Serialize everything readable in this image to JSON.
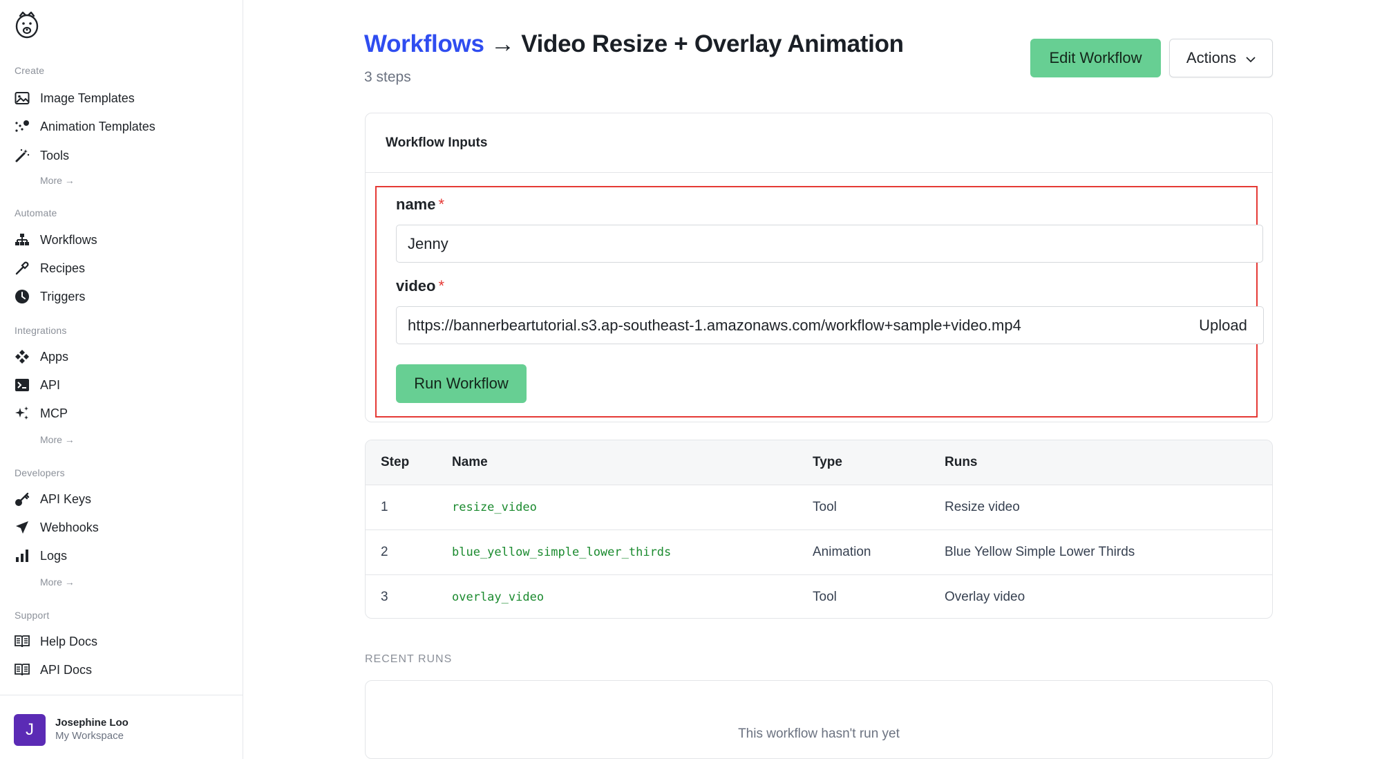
{
  "sidebar": {
    "sections": [
      {
        "title": "Create",
        "items": [
          {
            "label": "Image Templates",
            "icon": "image-icon"
          },
          {
            "label": "Animation Templates",
            "icon": "animation-icon"
          },
          {
            "label": "Tools",
            "icon": "magic-wand-icon"
          }
        ],
        "more": "More →"
      },
      {
        "title": "Automate",
        "items": [
          {
            "label": "Workflows",
            "icon": "sitemap-icon"
          },
          {
            "label": "Recipes",
            "icon": "dropper-icon"
          },
          {
            "label": "Triggers",
            "icon": "clock-icon"
          }
        ]
      },
      {
        "title": "Integrations",
        "items": [
          {
            "label": "Apps",
            "icon": "apps-diamond-icon"
          },
          {
            "label": "API",
            "icon": "terminal-icon"
          },
          {
            "label": "MCP",
            "icon": "sparkles-icon"
          }
        ],
        "more": "More →"
      },
      {
        "title": "Developers",
        "items": [
          {
            "label": "API Keys",
            "icon": "key-icon"
          },
          {
            "label": "Webhooks",
            "icon": "paper-plane-icon"
          },
          {
            "label": "Logs",
            "icon": "bar-chart-icon"
          }
        ],
        "more": "More →"
      },
      {
        "title": "Support",
        "items": [
          {
            "label": "Help Docs",
            "icon": "book-icon"
          },
          {
            "label": "API Docs",
            "icon": "book-icon"
          }
        ]
      }
    ],
    "user": {
      "initial": "J",
      "name": "Josephine Loo",
      "workspace": "My Workspace",
      "avatar_color": "#5b2bb5"
    }
  },
  "header": {
    "breadcrumb": "Workflows",
    "arrow": "→",
    "title": "Video Resize + Overlay Animation",
    "subtitle": "3 steps",
    "edit_button": "Edit Workflow",
    "actions_button": "Actions"
  },
  "inputs": {
    "heading": "Workflow Inputs",
    "fields": [
      {
        "label": "name",
        "required_mark": "*",
        "value": "Jenny"
      },
      {
        "label": "video",
        "required_mark": "*",
        "value": "https://bannerbeartutorial.s3.ap-southeast-1.amazonaws.com/workflow+sample+video.mp4"
      }
    ],
    "upload_button": "Upload",
    "run_button": "Run Workflow"
  },
  "steps_table": {
    "columns": [
      "Step",
      "Name",
      "Type",
      "Runs"
    ],
    "rows": [
      {
        "step": "1",
        "name": "resize_video",
        "type": "Tool",
        "runs": "Resize video"
      },
      {
        "step": "2",
        "name": "blue_yellow_simple_lower_thirds",
        "type": "Animation",
        "runs": "Blue Yellow Simple Lower Thirds"
      },
      {
        "step": "3",
        "name": "overlay_video",
        "type": "Tool",
        "runs": "Overlay video"
      }
    ]
  },
  "recent_runs": {
    "label": "RECENT RUNS",
    "empty_message": "This workflow hasn't run yet"
  },
  "colors": {
    "accent_green": "#67cf93",
    "breadcrumb_blue": "#2f4df0",
    "highlight_red": "#e53935",
    "code_green": "#1a8a2e"
  }
}
